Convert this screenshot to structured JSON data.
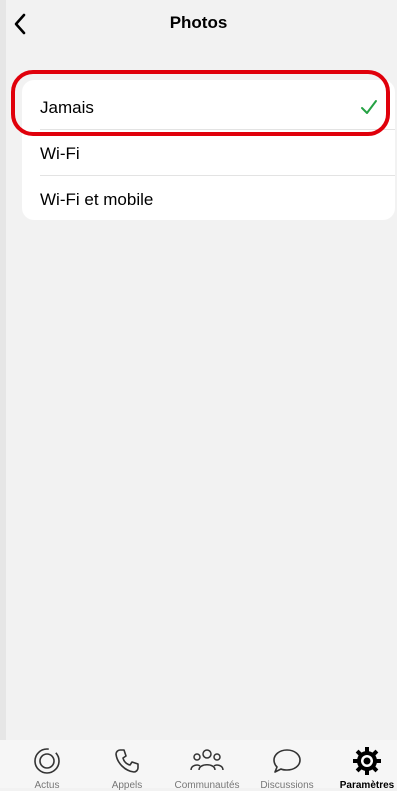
{
  "header": {
    "title": "Photos"
  },
  "options": [
    {
      "label": "Jamais",
      "selected": true
    },
    {
      "label": "Wi-Fi",
      "selected": false
    },
    {
      "label": "Wi-Fi et mobile",
      "selected": false
    }
  ],
  "tabbar": {
    "items": [
      {
        "label": "Actus",
        "icon": "status-icon",
        "active": false
      },
      {
        "label": "Appels",
        "icon": "phone-icon",
        "active": false
      },
      {
        "label": "Communautés",
        "icon": "communities-icon",
        "active": false
      },
      {
        "label": "Discussions",
        "icon": "chat-bubble-icon",
        "active": false
      },
      {
        "label": "Paramètres",
        "icon": "gear-icon",
        "active": true
      }
    ]
  },
  "colors": {
    "check": "#25a244",
    "highlight": "#e0000b",
    "background": "#f2f2f2"
  }
}
